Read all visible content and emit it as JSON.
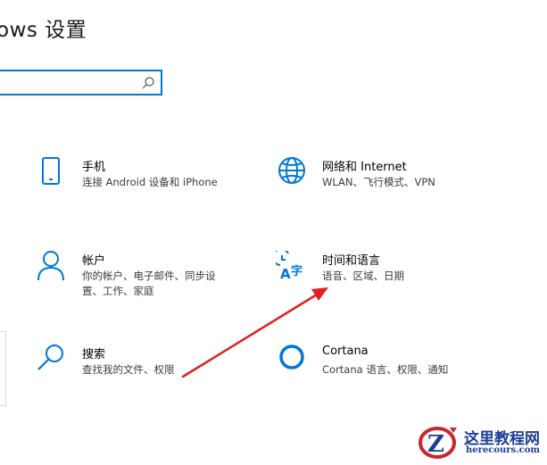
{
  "header": {
    "title": "ows 设置"
  },
  "search": {
    "value": "",
    "placeholder": ""
  },
  "tiles": [
    {
      "name": "手机",
      "desc": "连接 Android 设备和 iPhone",
      "icon": "phone-icon"
    },
    {
      "name": "网络和 Internet",
      "desc": "WLAN、飞行模式、VPN",
      "icon": "globe-icon"
    },
    {
      "name": "帐户",
      "desc": "你的帐户、电子邮件、同步设置、工作、家庭",
      "icon": "person-icon"
    },
    {
      "name": "时间和语言",
      "desc": "语音、区域、日期",
      "icon": "time-language-icon"
    },
    {
      "name": "搜索",
      "desc": "查找我的文件、权限",
      "icon": "search-icon"
    },
    {
      "name": "Cortana",
      "desc": "Cortana 语言、权限、通知",
      "icon": "cortana-icon"
    }
  ],
  "watermark": {
    "text": "这里教程网",
    "sub": "herecours.com"
  },
  "colors": {
    "accent": "#0078d7",
    "arrow": "#e02020"
  }
}
